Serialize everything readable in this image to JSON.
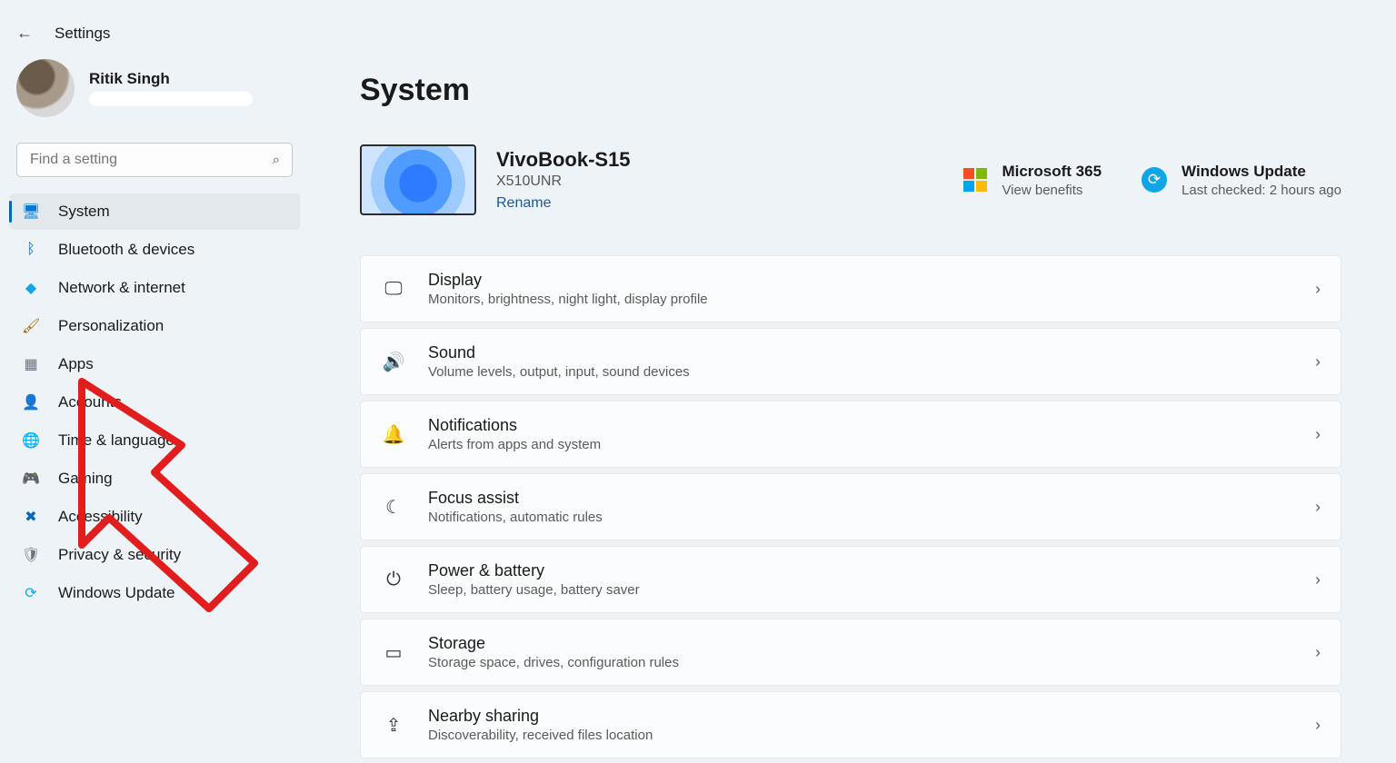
{
  "header": {
    "title": "Settings"
  },
  "profile": {
    "name": "Ritik Singh"
  },
  "search": {
    "placeholder": "Find a setting"
  },
  "sidebar": {
    "items": [
      {
        "label": "System",
        "icon": "🖥",
        "cls": "ic-system",
        "active": true
      },
      {
        "label": "Bluetooth & devices",
        "icon": "ᛒ",
        "cls": "ic-bt"
      },
      {
        "label": "Network & internet",
        "icon": "◆",
        "cls": "ic-net"
      },
      {
        "label": "Personalization",
        "icon": "🖌",
        "cls": "ic-pers"
      },
      {
        "label": "Apps",
        "icon": "▦",
        "cls": "ic-apps"
      },
      {
        "label": "Accounts",
        "icon": "👤",
        "cls": "ic-acct"
      },
      {
        "label": "Time & language",
        "icon": "🌐",
        "cls": "ic-time"
      },
      {
        "label": "Gaming",
        "icon": "🎮",
        "cls": "ic-game"
      },
      {
        "label": "Accessibility",
        "icon": "✖",
        "cls": "ic-access"
      },
      {
        "label": "Privacy & security",
        "icon": "🛡",
        "cls": "ic-priv"
      },
      {
        "label": "Windows Update",
        "icon": "⟳",
        "cls": "ic-wu"
      }
    ]
  },
  "main": {
    "title": "System",
    "device": {
      "name": "VivoBook-S15",
      "model": "X510UNR",
      "rename": "Rename"
    },
    "promos": {
      "m365": {
        "title": "Microsoft 365",
        "sub": "View benefits"
      },
      "wu": {
        "title": "Windows Update",
        "sub": "Last checked: 2 hours ago"
      }
    },
    "cards": [
      {
        "icon": "🖵",
        "title": "Display",
        "desc": "Monitors, brightness, night light, display profile"
      },
      {
        "icon": "🔊",
        "title": "Sound",
        "desc": "Volume levels, output, input, sound devices"
      },
      {
        "icon": "🔔",
        "title": "Notifications",
        "desc": "Alerts from apps and system"
      },
      {
        "icon": "☾",
        "title": "Focus assist",
        "desc": "Notifications, automatic rules"
      },
      {
        "icon": "⏻",
        "title": "Power & battery",
        "desc": "Sleep, battery usage, battery saver"
      },
      {
        "icon": "▭",
        "title": "Storage",
        "desc": "Storage space, drives, configuration rules"
      },
      {
        "icon": "⇪",
        "title": "Nearby sharing",
        "desc": "Discoverability, received files location"
      }
    ]
  }
}
